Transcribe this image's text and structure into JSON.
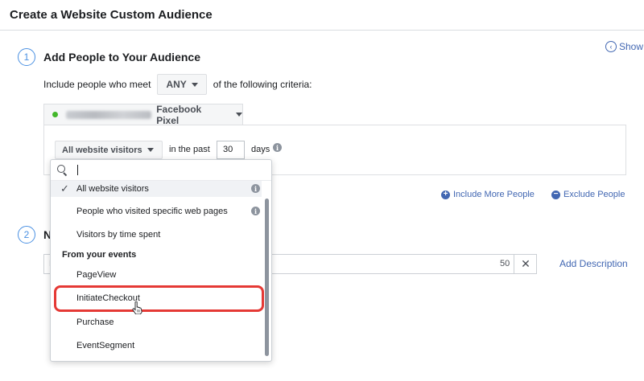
{
  "header": {
    "title": "Create a Website Custom Audience"
  },
  "show_link": {
    "label": "Show"
  },
  "section1": {
    "number": "1",
    "title": "Add People to Your Audience"
  },
  "criteria": {
    "prefix": "Include people who meet",
    "match": "ANY",
    "suffix": "of the following criteria:"
  },
  "pixel": {
    "name": "Facebook Pixel",
    "status_color": "#42b72a"
  },
  "rule": {
    "visitors": "All website visitors",
    "in_past": "in the past",
    "days": "30",
    "days_label": "days"
  },
  "actions": {
    "include_more": "Include More People",
    "exclude": "Exclude People"
  },
  "section2": {
    "number": "2",
    "title": "N"
  },
  "name_field": {
    "placeholder": "N",
    "count": "50",
    "clear": "✕"
  },
  "add_description": "Add Description",
  "dropdown": {
    "search_value": "",
    "items": [
      {
        "label": "All website visitors",
        "selected": true
      },
      {
        "label": "People who visited specific web pages"
      },
      {
        "label": "Visitors by time spent"
      }
    ],
    "group_label": "From your events",
    "events": [
      "PageView",
      "InitiateCheckout",
      "Purchase",
      "EventSegment"
    ]
  },
  "colors": {
    "link": "#4267b2",
    "highlight": "#e53935",
    "step_circle": "#4a90e2"
  }
}
